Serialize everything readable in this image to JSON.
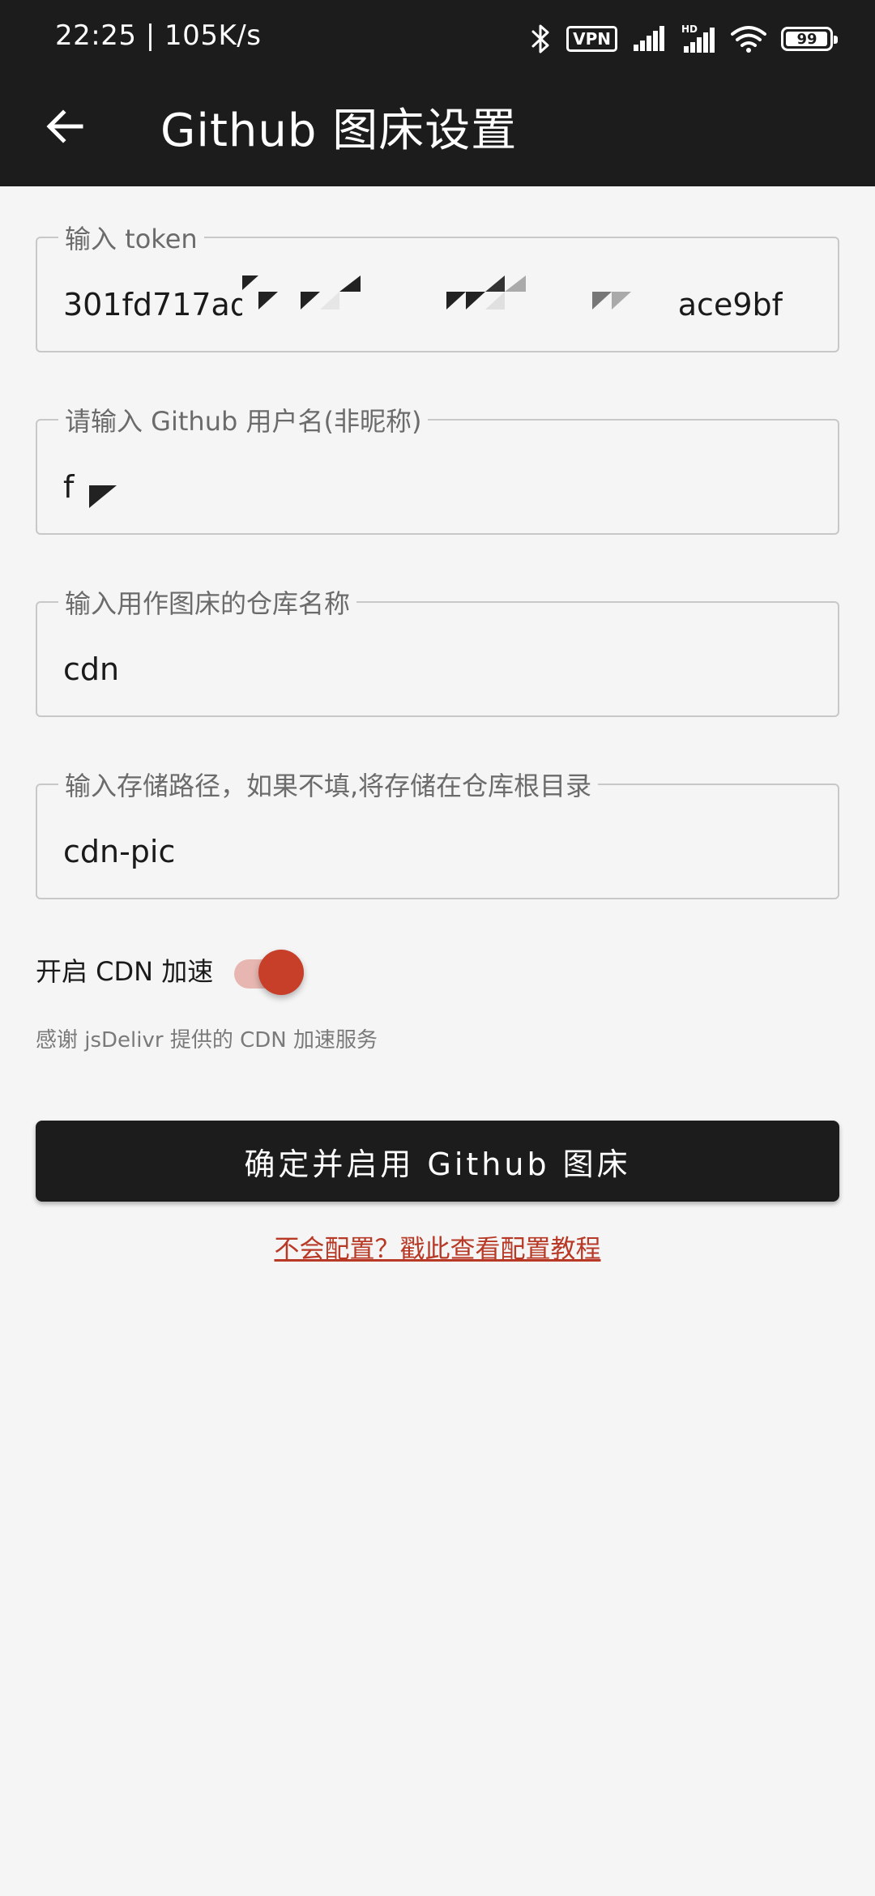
{
  "status_bar": {
    "time": "22:25 | 105K/s",
    "vpn": "VPN",
    "battery_level": "99",
    "icons": [
      "bluetooth-icon",
      "vpn-icon",
      "signal-icon",
      "hd-signal-icon",
      "wifi-icon",
      "battery-icon"
    ]
  },
  "app_bar": {
    "title": "Github 图床设置",
    "back_icon": "arrow-left-icon"
  },
  "form": {
    "token": {
      "label": "输入 token",
      "value_start": "301fd717ad",
      "value_end": "ace9bf"
    },
    "username": {
      "label": "请输入 Github 用户名(非昵称)",
      "value": "f"
    },
    "repo": {
      "label": "输入用作图床的仓库名称",
      "value": "cdn"
    },
    "path": {
      "label": "输入存储路径，如果不填,将存储在仓库根目录",
      "value": "cdn-pic"
    }
  },
  "cdn": {
    "label": "开启 CDN 加速",
    "enabled": true,
    "credit": "感谢 jsDelivr 提供的 CDN 加速服务"
  },
  "actions": {
    "confirm_label": "确定并启用 Github 图床",
    "help_link": "不会配置？戳此查看配置教程"
  },
  "colors": {
    "bar": "#1c1c1c",
    "background": "#f5f5f5",
    "accent": "#c73e29",
    "accent_track": "#e7b6b0",
    "link": "#b83a26"
  }
}
